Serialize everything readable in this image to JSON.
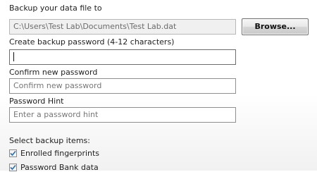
{
  "backup_file": {
    "label": "Backup your data file to",
    "path": "C:\\Users\\Test Lab\\Documents\\Test Lab.dat",
    "browse_label": "Browse..."
  },
  "create_password": {
    "label": "Create backup password (4-12 characters)",
    "value": ""
  },
  "confirm_password": {
    "label": "Confirm new password",
    "placeholder": "Confirm new password"
  },
  "password_hint": {
    "label": "Password Hint",
    "placeholder": "Enter a password hint"
  },
  "backup_items": {
    "label": "Select backup items:",
    "items": [
      {
        "label": "Enrolled fingerprints",
        "checked": true
      },
      {
        "label": "Password Bank data",
        "checked": true
      }
    ]
  },
  "colors": {
    "check_mark": "#2a6fb5"
  },
  "icons": {
    "checkbox": "checkmark-icon"
  }
}
